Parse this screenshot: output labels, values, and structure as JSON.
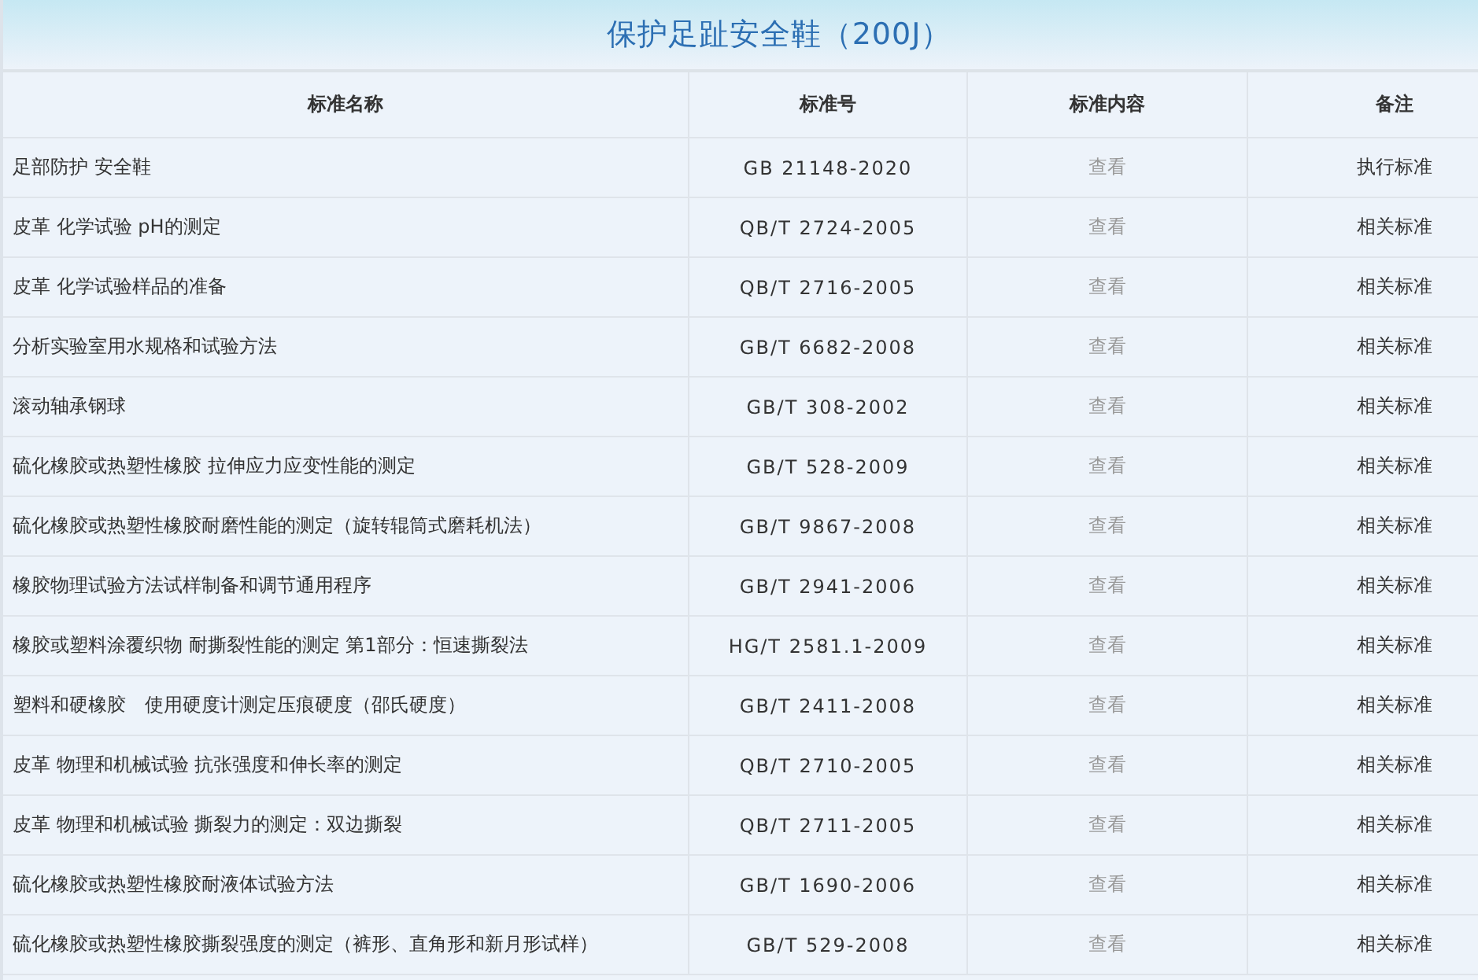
{
  "title": "保护足趾安全鞋（200J）",
  "table": {
    "columns": [
      "标准名称",
      "标准号",
      "标准内容",
      "备注"
    ],
    "rows": [
      {
        "name": "足部防护 安全鞋",
        "number": "GB 21148-2020",
        "content": {
          "label": "查看",
          "disabled": true
        },
        "remark": "执行标准"
      },
      {
        "name": "皮革 化学试验 pH的测定",
        "number": "QB/T 2724-2005",
        "content": {
          "label": "查看",
          "disabled": true
        },
        "remark": "相关标准"
      },
      {
        "name": "皮革 化学试验样品的准备",
        "number": "QB/T 2716-2005",
        "content": {
          "label": "查看",
          "disabled": true
        },
        "remark": "相关标准"
      },
      {
        "name": "分析实验室用水规格和试验方法",
        "number": "GB/T 6682-2008",
        "content": {
          "label": "查看",
          "disabled": true
        },
        "remark": "相关标准"
      },
      {
        "name": "滚动轴承钢球",
        "number": "GB/T 308-2002",
        "content": {
          "label": "查看",
          "disabled": true
        },
        "remark": "相关标准"
      },
      {
        "name": "硫化橡胶或热塑性橡胶 拉伸应力应变性能的测定",
        "number": "GB/T 528-2009",
        "content": {
          "label": "查看",
          "disabled": true
        },
        "remark": "相关标准"
      },
      {
        "name": "硫化橡胶或热塑性橡胶耐磨性能的测定（旋转辊筒式磨耗机法）",
        "number": "GB/T 9867-2008",
        "content": {
          "label": "查看",
          "disabled": true
        },
        "remark": "相关标准"
      },
      {
        "name": "橡胶物理试验方法试样制备和调节通用程序",
        "number": "GB/T 2941-2006",
        "content": {
          "label": "查看",
          "disabled": true
        },
        "remark": "相关标准"
      },
      {
        "name": "橡胶或塑料涂覆织物 耐撕裂性能的测定 第1部分：恒速撕裂法",
        "number": "HG/T 2581.1-2009",
        "content": {
          "label": "查看",
          "disabled": true
        },
        "remark": "相关标准"
      },
      {
        "name": "塑料和硬橡胶　使用硬度计测定压痕硬度（邵氏硬度）",
        "number": "GB/T 2411-2008",
        "content": {
          "label": "查看",
          "disabled": true
        },
        "remark": "相关标准"
      },
      {
        "name": "皮革 物理和机械试验 抗张强度和伸长率的测定",
        "number": "QB/T 2710-2005",
        "content": {
          "label": "查看",
          "disabled": true
        },
        "remark": "相关标准"
      },
      {
        "name": "皮革 物理和机械试验 撕裂力的测定：双边撕裂",
        "number": "QB/T 2711-2005",
        "content": {
          "label": "查看",
          "disabled": true
        },
        "remark": "相关标准"
      },
      {
        "name": "硫化橡胶或热塑性橡胶耐液体试验方法",
        "number": "GB/T 1690-2006",
        "content": {
          "label": "查看",
          "disabled": true
        },
        "remark": "相关标准"
      },
      {
        "name": "硫化橡胶或热塑性橡胶撕裂强度的测定（裤形、直角形和新月形试样）",
        "number": "GB/T 529-2008",
        "content": {
          "label": "查看",
          "disabled": true
        },
        "remark": "相关标准"
      }
    ]
  }
}
